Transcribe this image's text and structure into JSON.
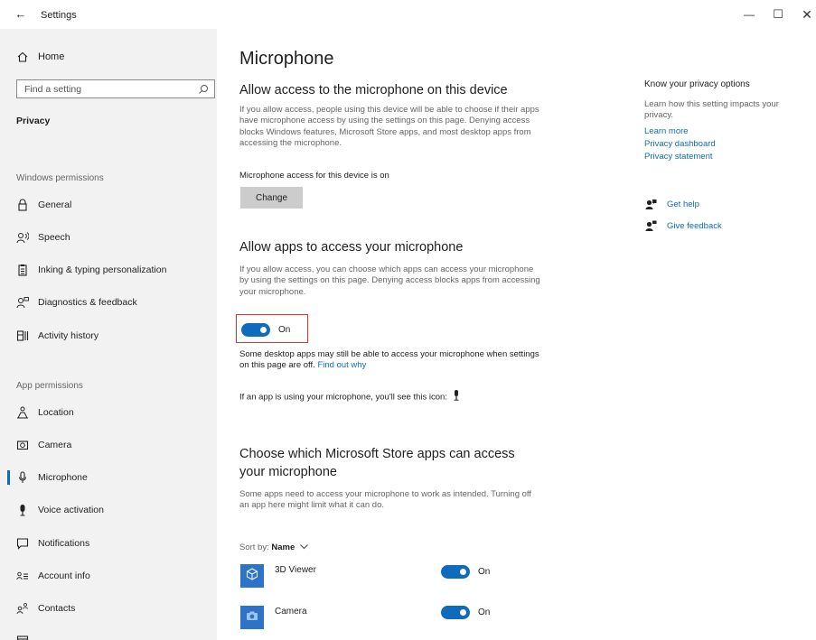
{
  "window": {
    "title": "Settings",
    "back_glyph": "←",
    "minimize_glyph": "—",
    "maximize_glyph": "☐",
    "close_glyph": "✕"
  },
  "sidebar": {
    "home": "Home",
    "search_placeholder": "Find a setting",
    "section": "Privacy",
    "windows_permissions_heading": "Windows permissions",
    "windows_permissions": [
      {
        "label": "General",
        "icon": "lock-icon"
      },
      {
        "label": "Speech",
        "icon": "speech-icon"
      },
      {
        "label": "Inking & typing personalization",
        "icon": "clipboard-icon"
      },
      {
        "label": "Diagnostics & feedback",
        "icon": "feedback-person-icon"
      },
      {
        "label": "Activity history",
        "icon": "activity-history-icon"
      }
    ],
    "app_permissions_heading": "App permissions",
    "app_permissions": [
      {
        "label": "Location",
        "icon": "location-person-icon"
      },
      {
        "label": "Camera",
        "icon": "camera-icon"
      },
      {
        "label": "Microphone",
        "icon": "microphone-outline-icon",
        "active": true
      },
      {
        "label": "Voice activation",
        "icon": "microphone-filled-icon"
      },
      {
        "label": "Notifications",
        "icon": "notification-icon"
      },
      {
        "label": "Account info",
        "icon": "account-info-icon"
      },
      {
        "label": "Contacts",
        "icon": "contacts-icon"
      }
    ]
  },
  "main": {
    "page_title": "Microphone",
    "device_access": {
      "title": "Allow access to the microphone on this device",
      "description": "If you allow access, people using this device will be able to choose if their apps have microphone access by using the settings on this page. Denying access blocks Windows features, Microsoft Store apps, and most desktop apps from accessing the microphone.",
      "status": "Microphone access for this device is on",
      "change_button": "Change"
    },
    "app_access": {
      "title": "Allow apps to access your microphone",
      "description": "If you allow access, you can choose which apps can access your microphone by using the settings on this page. Denying access blocks apps from accessing your microphone.",
      "toggle_state": "On",
      "toggle_on": true,
      "desktop_note": "Some desktop apps may still be able to access your microphone when settings on this page are off.",
      "find_out_why": "Find out why",
      "icon_note": "If an app is using your microphone, you'll see this icon:"
    },
    "store_apps": {
      "title_line1": "Choose which Microsoft Store apps can access",
      "title_line2": "your microphone",
      "description": "Some apps need to access your microphone to work as intended. Turning off an app here might limit what it can do.",
      "sort_label": "Sort by:",
      "sort_value": "Name",
      "apps": [
        {
          "name": "3D Viewer",
          "state": "On",
          "on": true,
          "icon": "cube-icon"
        },
        {
          "name": "Camera",
          "state": "On",
          "on": true,
          "icon": "camera-app-icon"
        }
      ]
    }
  },
  "right": {
    "title": "Know your privacy options",
    "description": "Learn how this setting impacts your privacy.",
    "links": [
      "Learn more",
      "Privacy dashboard",
      "Privacy statement"
    ],
    "get_help": "Get help",
    "give_feedback": "Give feedback"
  },
  "colors": {
    "accent": "#0f6cbd",
    "sidebar_bg": "#f2f2f2",
    "highlight_border": "#e0312f",
    "button_bg": "#cccccc"
  }
}
